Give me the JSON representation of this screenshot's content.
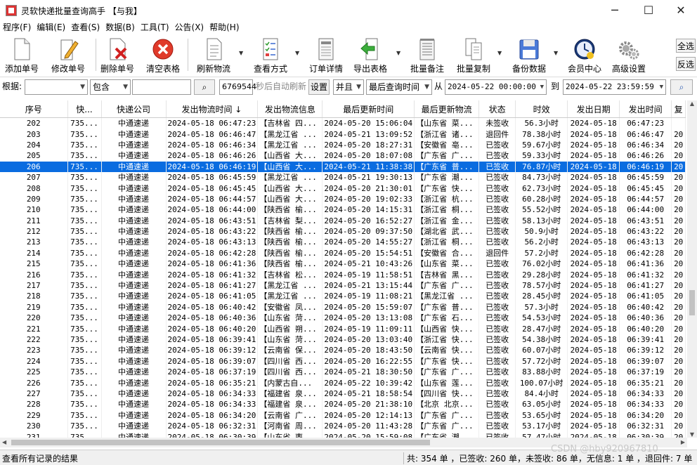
{
  "window": {
    "title": "灵软快递批量查询高手 【与我】",
    "min": "─",
    "max": "☐",
    "close": "✕"
  },
  "menu": [
    "程序(F)",
    "编辑(E)",
    "查看(S)",
    "数据(B)",
    "工具(T)",
    "公告(X)",
    "帮助(H)"
  ],
  "toolbar": {
    "add": "添加单号",
    "edit": "修改单号",
    "delete": "删除单号",
    "clear": "清空表格",
    "refresh": "刷新物流",
    "view": "查看方式",
    "detail": "订单详情",
    "export": "导出表格",
    "note": "批量备注",
    "copy": "批量复制",
    "backup": "备份数据",
    "member": "会员中心",
    "settings": "高级设置",
    "select_all": "全选",
    "invert": "反选"
  },
  "filter": {
    "by_label": "根据:",
    "by_value": "",
    "mode_value": "包含",
    "keyword": "",
    "interval": "6769544",
    "auto_refresh_label": "秒后自动刷新",
    "set_button": "设置",
    "logic": "并且",
    "time_field": "最后查询时间",
    "from_label": "从",
    "from_value": "2024-05-22 00:00:00",
    "to_label": "到",
    "to_value": "2024-05-22 23:59:59"
  },
  "table": {
    "columns": [
      "序号",
      "快...",
      "快递公司",
      "发出物流时间 ↓",
      "发出物流信息",
      "最后更新时间",
      "最后更新物流",
      "状态",
      "时效",
      "发出日期",
      "发出时间",
      "复"
    ],
    "rows": [
      [
        "202",
        "735...",
        "中通速递",
        "2024-05-18 06:47:23",
        "【吉林省 四...",
        "2024-05-20 15:06:04",
        "【山东省 菜...",
        "未签收",
        "56.3小时",
        "2024-05-18",
        "06:47:23",
        ""
      ],
      [
        "203",
        "735...",
        "中通速递",
        "2024-05-18 06:46:47",
        "【黑龙江省 ...",
        "2024-05-21 13:09:52",
        "【浙江省 诸...",
        "退回件",
        "78.38小时",
        "2024-05-18",
        "06:46:47",
        "20"
      ],
      [
        "204",
        "735...",
        "中通速递",
        "2024-05-18 06:46:34",
        "【黑龙江省 ...",
        "2024-05-20 18:27:31",
        "【安徽省 亳...",
        "已签收",
        "59.67小时",
        "2024-05-18",
        "06:46:34",
        "20"
      ],
      [
        "205",
        "735...",
        "中通速递",
        "2024-05-18 06:46:26",
        "【山西省 大...",
        "2024-05-20 18:07:08",
        "【广东省 广...",
        "已签收",
        "59.33小时",
        "2024-05-18",
        "06:46:26",
        "20"
      ],
      [
        "206",
        "735...",
        "中通速递",
        "2024-05-18 06:46:19",
        "【山西省 大...",
        "2024-05-21 11:38:38",
        "【广东省 普...",
        "已签收",
        "76.87小时",
        "2024-05-18",
        "06:46:19",
        "20"
      ],
      [
        "207",
        "735...",
        "中通速递",
        "2024-05-18 06:45:59",
        "【黑龙江省 ...",
        "2024-05-21 19:30:13",
        "【广东省 潮...",
        "已签收",
        "84.73小时",
        "2024-05-18",
        "06:45:59",
        "20"
      ],
      [
        "208",
        "735...",
        "中通速递",
        "2024-05-18 06:45:45",
        "【山西省 大...",
        "2024-05-20 21:30:01",
        "【广东省 快...",
        "已签收",
        "62.73小时",
        "2024-05-18",
        "06:45:45",
        "20"
      ],
      [
        "209",
        "735...",
        "中通速递",
        "2024-05-18 06:44:57",
        "【山西省 大...",
        "2024-05-20 19:02:33",
        "【浙江省 杭...",
        "已签收",
        "60.28小时",
        "2024-05-18",
        "06:44:57",
        "20"
      ],
      [
        "210",
        "735...",
        "中通速递",
        "2024-05-18 06:44:00",
        "【陕西省 榆...",
        "2024-05-20 14:15:31",
        "【浙江省 桐...",
        "已签收",
        "55.52小时",
        "2024-05-18",
        "06:44:00",
        "20"
      ],
      [
        "211",
        "735...",
        "中通速递",
        "2024-05-18 06:43:51",
        "【吉林省 梨...",
        "2024-05-20 16:52:27",
        "【浙江省 金...",
        "已签收",
        "58.13小时",
        "2024-05-18",
        "06:43:51",
        "20"
      ],
      [
        "212",
        "735...",
        "中通速递",
        "2024-05-18 06:43:22",
        "【陕西省 榆...",
        "2024-05-20 09:37:50",
        "【湖北省 武...",
        "已签收",
        "50.9小时",
        "2024-05-18",
        "06:43:22",
        "20"
      ],
      [
        "213",
        "735...",
        "中通速递",
        "2024-05-18 06:43:13",
        "【陕西省 榆...",
        "2024-05-20 14:55:27",
        "【浙江省 桐...",
        "已签收",
        "56.2小时",
        "2024-05-18",
        "06:43:13",
        "20"
      ],
      [
        "214",
        "735...",
        "中通速递",
        "2024-05-18 06:42:28",
        "【陕西省 榆...",
        "2024-05-20 15:54:51",
        "【安徽省 合...",
        "退回件",
        "57.2小时",
        "2024-05-18",
        "06:42:28",
        "20"
      ],
      [
        "215",
        "735...",
        "中通速递",
        "2024-05-18 06:41:36",
        "【陕西省 榆...",
        "2024-05-21 10:43:26",
        "【山东省 菜...",
        "已签收",
        "76.02小时",
        "2024-05-18",
        "06:41:36",
        "20"
      ],
      [
        "216",
        "735...",
        "中通速递",
        "2024-05-18 06:41:32",
        "【吉林省 松...",
        "2024-05-19 11:58:51",
        "【吉林省 黑...",
        "已签收",
        "29.28小时",
        "2024-05-18",
        "06:41:32",
        "20"
      ],
      [
        "217",
        "735...",
        "中通速递",
        "2024-05-18 06:41:27",
        "【黑龙江省 ...",
        "2024-05-21 13:15:44",
        "【广东省 广...",
        "已签收",
        "78.57小时",
        "2024-05-18",
        "06:41:27",
        "20"
      ],
      [
        "218",
        "735...",
        "中通速递",
        "2024-05-18 06:41:05",
        "【黑龙江省 ...",
        "2024-05-19 11:08:21",
        "【黑龙江省 ...",
        "已签收",
        "28.45小时",
        "2024-05-18",
        "06:41:05",
        "20"
      ],
      [
        "219",
        "735...",
        "中通速递",
        "2024-05-18 06:40:42",
        "【安徽省 凤...",
        "2024-05-20 15:59:07",
        "【广东省 普...",
        "已签收",
        "57.3小时",
        "2024-05-18",
        "06:40:42",
        "20"
      ],
      [
        "220",
        "735...",
        "中通速递",
        "2024-05-18 06:40:36",
        "【山东省 菏...",
        "2024-05-20 13:13:08",
        "【广东省 石...",
        "已签收",
        "54.53小时",
        "2024-05-18",
        "06:40:36",
        "20"
      ],
      [
        "221",
        "735...",
        "中通速递",
        "2024-05-18 06:40:20",
        "【山西省 朔...",
        "2024-05-19 11:09:11",
        "【山西省 快...",
        "已签收",
        "28.47小时",
        "2024-05-18",
        "06:40:20",
        "20"
      ],
      [
        "222",
        "735...",
        "中通速递",
        "2024-05-18 06:39:41",
        "【山东省 菏...",
        "2024-05-20 13:03:40",
        "【浙江省 快...",
        "已签收",
        "54.38小时",
        "2024-05-18",
        "06:39:41",
        "20"
      ],
      [
        "223",
        "735...",
        "中通速递",
        "2024-05-18 06:39:12",
        "【云南省 保...",
        "2024-05-20 18:43:50",
        "【云南省 快...",
        "已签收",
        "60.07小时",
        "2024-05-18",
        "06:39:12",
        "20"
      ],
      [
        "224",
        "735...",
        "中通速递",
        "2024-05-18 06:39:07",
        "【四川省 西...",
        "2024-05-20 16:22:55",
        "【广东省 快...",
        "已签收",
        "57.72小时",
        "2024-05-18",
        "06:39:07",
        "20"
      ],
      [
        "225",
        "735...",
        "中通速递",
        "2024-05-18 06:37:19",
        "【四川省 西...",
        "2024-05-21 18:30:50",
        "【广东省 广...",
        "已签收",
        "83.88小时",
        "2024-05-18",
        "06:37:19",
        "20"
      ],
      [
        "226",
        "735...",
        "中通速递",
        "2024-05-18 06:35:21",
        "【内蒙古自...",
        "2024-05-22 10:39:42",
        "【山东省 莲...",
        "已签收",
        "100.07小时",
        "2024-05-18",
        "06:35:21",
        "20"
      ],
      [
        "227",
        "735...",
        "中通速递",
        "2024-05-18 06:34:33",
        "【福建省 泉...",
        "2024-05-21 18:58:54",
        "【四川省 快...",
        "已签收",
        "84.4小时",
        "2024-05-18",
        "06:34:33",
        "20"
      ],
      [
        "228",
        "735...",
        "中通速递",
        "2024-05-18 06:34:33",
        "【福建省 泉...",
        "2024-05-20 21:38:10",
        "【北京 北京...",
        "已签收",
        "63.05小时",
        "2024-05-18",
        "06:34:33",
        "20"
      ],
      [
        "229",
        "735...",
        "中通速递",
        "2024-05-18 06:34:20",
        "【云南省 广...",
        "2024-05-20 12:14:13",
        "【广东省 广...",
        "已签收",
        "53.65小时",
        "2024-05-18",
        "06:34:20",
        "20"
      ],
      [
        "230",
        "735...",
        "中通速递",
        "2024-05-18 06:32:31",
        "【河南省 周...",
        "2024-05-20 11:43:28",
        "【广东省 广...",
        "已签收",
        "53.17小时",
        "2024-05-18",
        "06:32:31",
        "20"
      ],
      [
        "231",
        "735...",
        "中通速递",
        "2024-05-18 06:30:39",
        "【山东省 枣...",
        "2024-05-20 15:59:08",
        "【广东省 潮...",
        "已签收",
        "57.47小时",
        "2024-05-18",
        "06:30:39",
        "20"
      ]
    ],
    "selected_index": 4
  },
  "status": {
    "left": "查看所有记录的结果",
    "right": "共: 354 单 ，已签收: 260 单，未签收: 86 单，无信息: 1 单 ，退回件: 7 单"
  },
  "watermark": "CSDN @hby920967810"
}
